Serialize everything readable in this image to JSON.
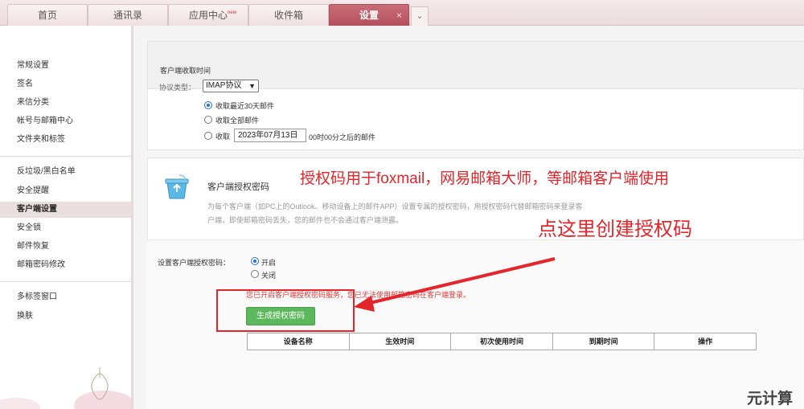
{
  "tabs": [
    {
      "label": "首页"
    },
    {
      "label": "通讯录"
    },
    {
      "label": "应用中心",
      "badge": "new"
    },
    {
      "label": "收件箱"
    },
    {
      "label": "设置",
      "close": "×"
    }
  ],
  "tab_more": "⌄",
  "sidebar": {
    "items": [
      {
        "label": "常规设置"
      },
      {
        "label": "签名"
      },
      {
        "label": "来信分类"
      },
      {
        "label": "帐号与邮箱中心"
      },
      {
        "label": "文件夹和标签"
      },
      {
        "label": "反垃圾/黑白名单"
      },
      {
        "label": "安全提醒"
      },
      {
        "label": "客户端设置"
      },
      {
        "label": "安全锁"
      },
      {
        "label": "邮件恢复"
      },
      {
        "label": "邮箱密码修改"
      },
      {
        "label": "多标签窗口"
      },
      {
        "label": "换肤"
      }
    ]
  },
  "receive": {
    "section_title": "客户端收取时间",
    "protocol_label": "协议类型：",
    "protocol_value": "IMAP协议",
    "options": [
      {
        "label": "收取最近30天邮件",
        "selected": true
      },
      {
        "label": "收取全部邮件",
        "selected": false
      },
      {
        "label": "收取",
        "selected": false
      }
    ],
    "date_value": "2023年07月13日",
    "date_suffix": "00时00分之后的邮件"
  },
  "auth": {
    "title": "客户端授权密码",
    "desc": "为每个客户端（如PC上的Outlook、移动设备上的邮件APP）设置专属的授权密码，用授权密码代替邮箱密码来登录客户端，即使邮箱密码丢失，您的邮件也不会通过客户端泄露。",
    "setting_label": "设置客户端授权密码：",
    "on_label": "开启",
    "off_label": "关闭",
    "warning": "您已开启客户端授权密码服务，您已无法使用邮箱密码在客户端登录。",
    "generate_button": "生成授权密码",
    "table_headers": [
      "设备名称",
      "生效时间",
      "初次使用时间",
      "到期时间",
      "操作"
    ]
  },
  "annotations": {
    "line1": "授权码用于foxmail，网易邮箱大师，等邮箱客户端使用",
    "line2": "点这里创建授权码",
    "color": "#e6252a"
  },
  "watermark": "元计算",
  "colors": {
    "active_tab": "#b5505d",
    "green_button": "#5cb85c",
    "radio_blue": "#2b6fd6"
  }
}
